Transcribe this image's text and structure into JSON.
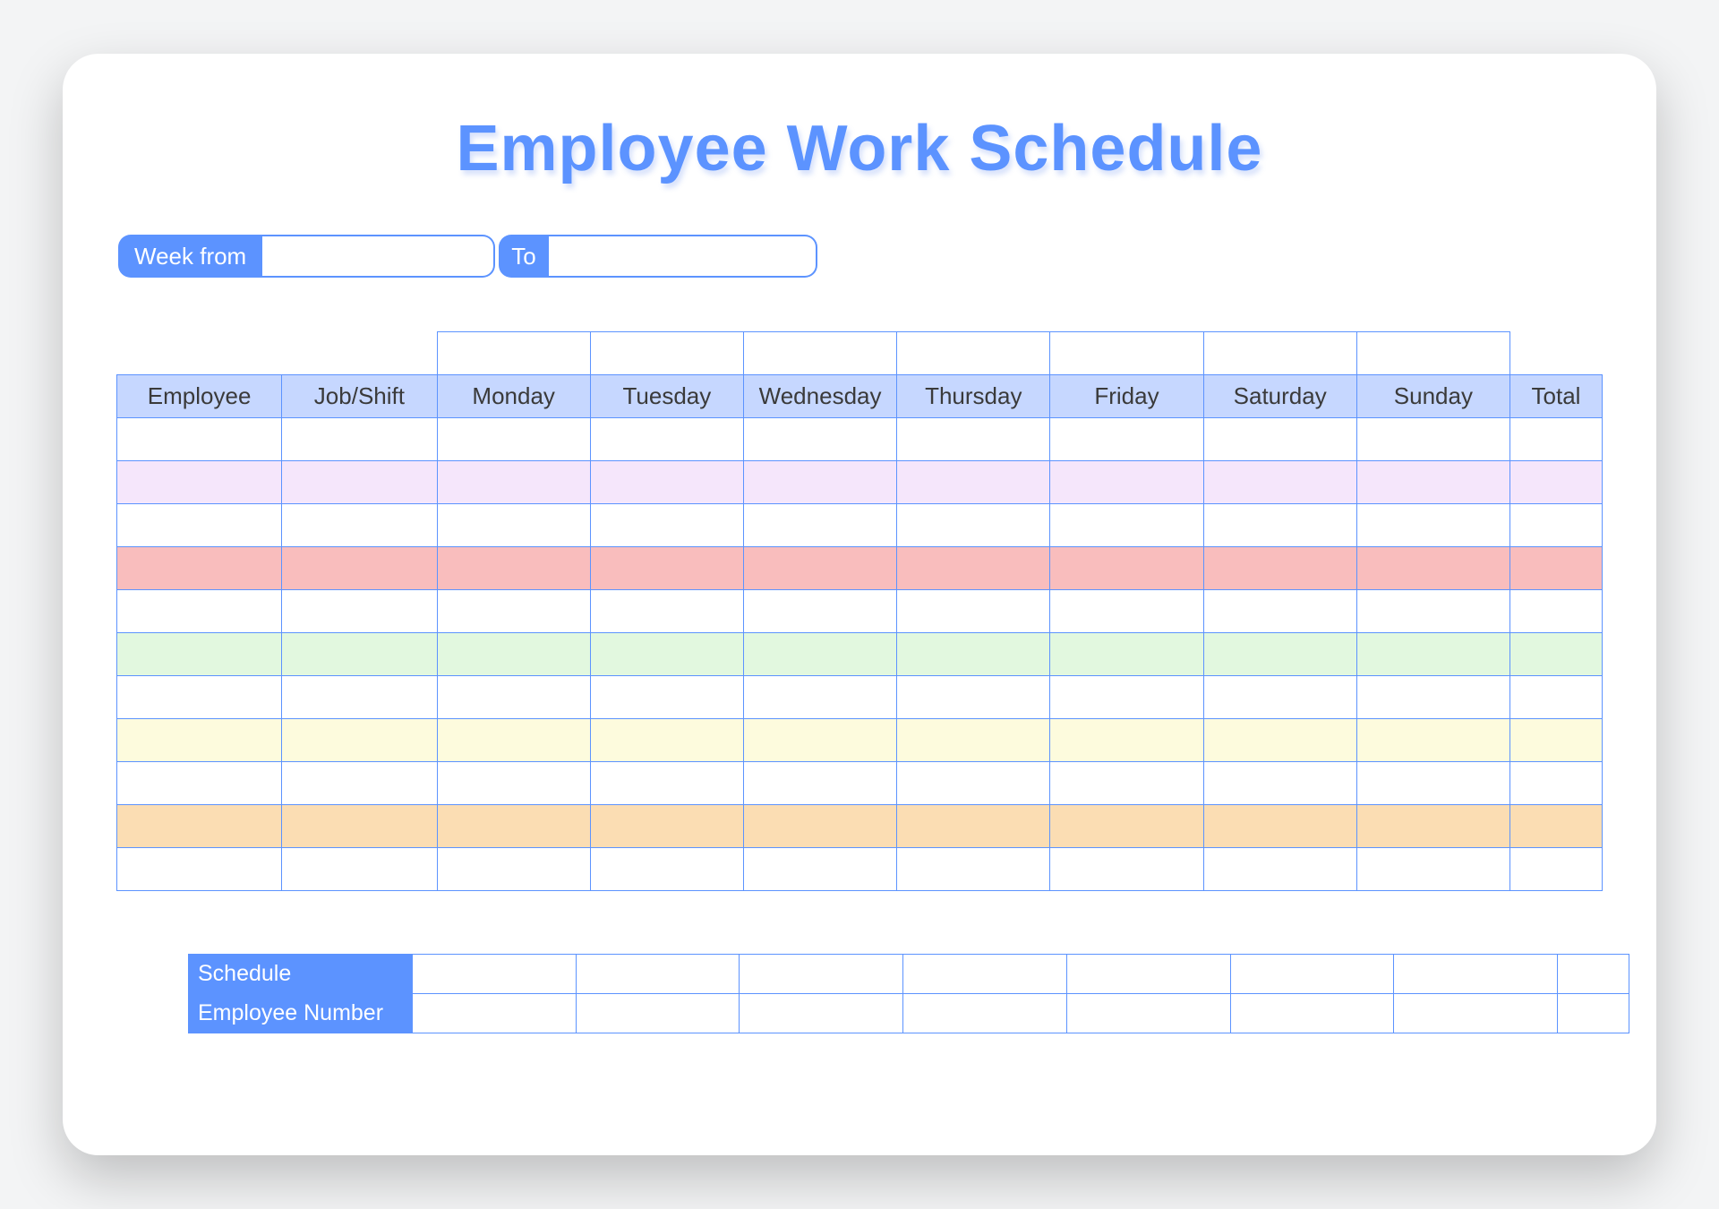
{
  "title": "Employee Work Schedule",
  "week": {
    "from_label": "Week from",
    "to_label": "To",
    "from_value": "",
    "to_value": ""
  },
  "headers": {
    "employee": "Employee",
    "job_shift": "Job/Shift",
    "days": [
      "Monday",
      "Tuesday",
      "Wednesday",
      "Thursday",
      "Friday",
      "Saturday",
      "Sunday"
    ],
    "total": "Total"
  },
  "date_row": [
    "",
    "",
    "",
    "",
    "",
    "",
    ""
  ],
  "rows": [
    {
      "color": "white",
      "employee": "",
      "job": "",
      "d": [
        "",
        "",
        "",
        "",
        "",
        "",
        ""
      ],
      "total": ""
    },
    {
      "color": "lav",
      "employee": "",
      "job": "",
      "d": [
        "",
        "",
        "",
        "",
        "",
        "",
        ""
      ],
      "total": ""
    },
    {
      "color": "white",
      "employee": "",
      "job": "",
      "d": [
        "",
        "",
        "",
        "",
        "",
        "",
        ""
      ],
      "total": ""
    },
    {
      "color": "pink",
      "employee": "",
      "job": "",
      "d": [
        "",
        "",
        "",
        "",
        "",
        "",
        ""
      ],
      "total": ""
    },
    {
      "color": "white",
      "employee": "",
      "job": "",
      "d": [
        "",
        "",
        "",
        "",
        "",
        "",
        ""
      ],
      "total": ""
    },
    {
      "color": "mint",
      "employee": "",
      "job": "",
      "d": [
        "",
        "",
        "",
        "",
        "",
        "",
        ""
      ],
      "total": ""
    },
    {
      "color": "white",
      "employee": "",
      "job": "",
      "d": [
        "",
        "",
        "",
        "",
        "",
        "",
        ""
      ],
      "total": ""
    },
    {
      "color": "cream",
      "employee": "",
      "job": "",
      "d": [
        "",
        "",
        "",
        "",
        "",
        "",
        ""
      ],
      "total": ""
    },
    {
      "color": "white",
      "employee": "",
      "job": "",
      "d": [
        "",
        "",
        "",
        "",
        "",
        "",
        ""
      ],
      "total": ""
    },
    {
      "color": "peach",
      "employee": "",
      "job": "",
      "d": [
        "",
        "",
        "",
        "",
        "",
        "",
        ""
      ],
      "total": ""
    },
    {
      "color": "white",
      "employee": "",
      "job": "",
      "d": [
        "",
        "",
        "",
        "",
        "",
        "",
        ""
      ],
      "total": ""
    }
  ],
  "summary": {
    "schedule_label": "Schedule",
    "emp_num_label": "Employee Number",
    "schedule_values": [
      "",
      "",
      "",
      "",
      "",
      "",
      "",
      ""
    ],
    "emp_num_values": [
      "",
      "",
      "",
      "",
      "",
      "",
      "",
      ""
    ]
  }
}
